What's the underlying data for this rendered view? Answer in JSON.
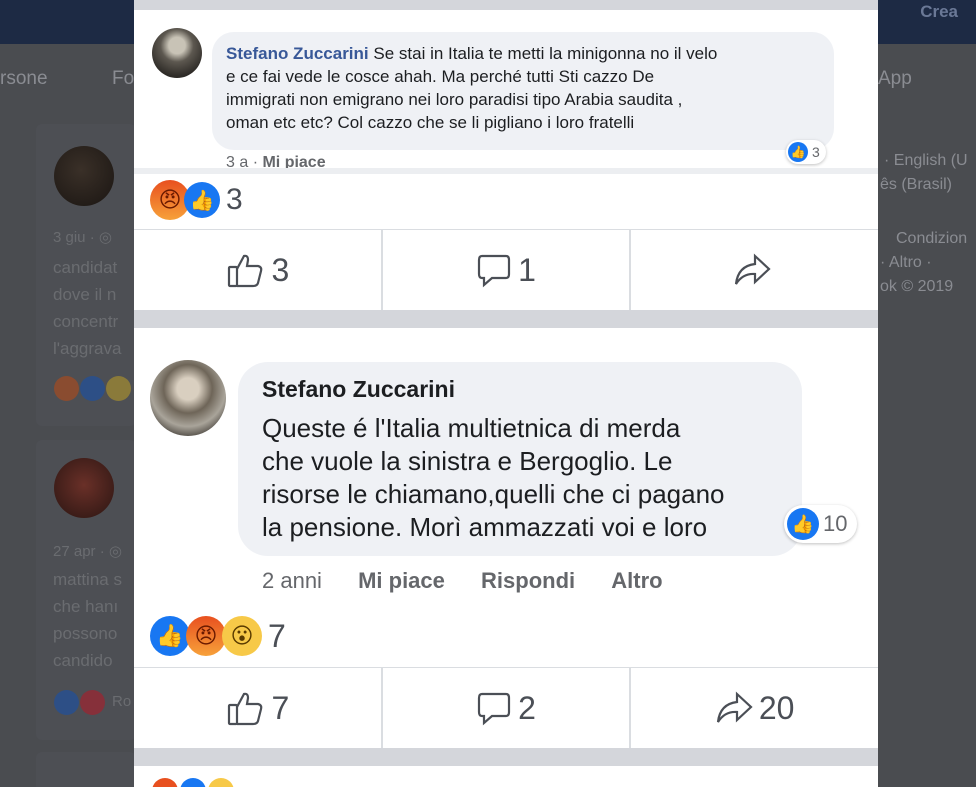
{
  "background": {
    "crea": "Crea",
    "nav": [
      "rsone",
      "Fo",
      "App"
    ],
    "right_links": [
      "· English (U",
      "ês (Brasil)",
      "Condizion",
      "· Altro ·",
      "ok © 2019"
    ],
    "post1": {
      "meta": "3 giu · ",
      "lines": [
        "candidat",
        "dove il n",
        "concentr",
        "l'aggrava"
      ]
    },
    "post2": {
      "meta": "27 apr · ",
      "lines": [
        "mattina s",
        "che hanı",
        "possono",
        "candido"
      ],
      "react_text": "Ro"
    }
  },
  "comment1": {
    "author": "Stefano Zuccarini",
    "text_lines": [
      "Se stai in Italia te metti la minigonna no il velo",
      "e ce fai vede le cosce ahah. Ma perché tutti Sti cazzo De",
      "immigrati non emigrano nei loro paradisi tipo Arabia saudita ,",
      "oman etc etc? Col cazzo che se li pigliano i loro fratelli"
    ],
    "time": "3 a",
    "like_label": "Mi piace",
    "reaction_count": "3"
  },
  "post1_reactions": {
    "count": "3",
    "likes": "3",
    "comments": "1",
    "shares": ""
  },
  "comment2": {
    "author": "Stefano Zuccarini",
    "text_lines": [
      "Queste é l'Italia multietnica di merda",
      "che vuole la sinistra e Bergoglio. Le",
      "risorse le chiamano,quelli che ci pagano",
      "la pensione. Morì ammazzati voi e loro"
    ],
    "time": "2 anni",
    "like_label": "Mi piace",
    "reply_label": "Rispondi",
    "more_label": "Altro",
    "reaction_count": "10"
  },
  "post2_reactions": {
    "count": "7",
    "likes": "7",
    "comments": "2",
    "shares": "20"
  },
  "colors": {
    "link_blue": "#385898",
    "like_blue": "#1877f2",
    "angry_orange": "#e8501f",
    "wow_yellow": "#f7c948"
  }
}
